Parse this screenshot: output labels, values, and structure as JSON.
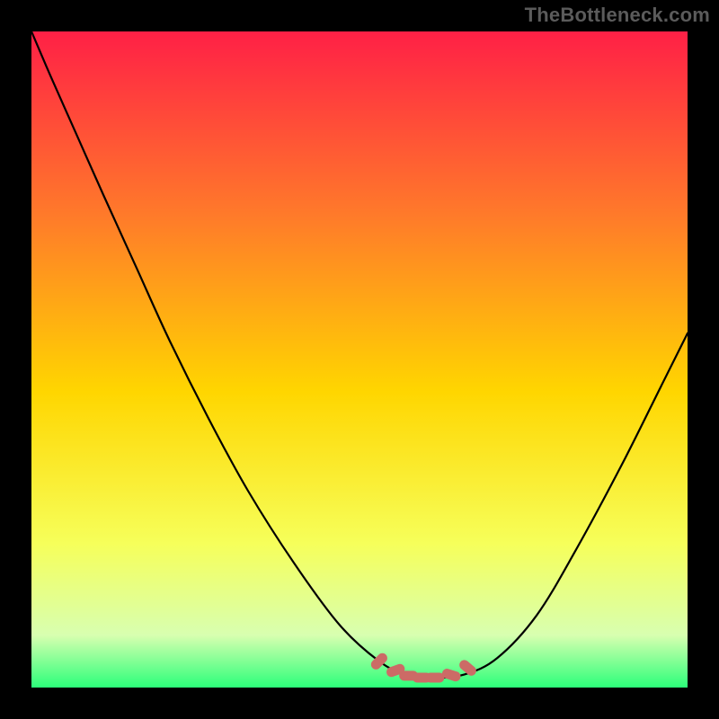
{
  "attribution": "TheBottleneck.com",
  "colors": {
    "background": "#000000",
    "attribution_text": "#5b5b5b",
    "gradient_top": "#ff2046",
    "gradient_upper_mid": "#ff7a2a",
    "gradient_mid": "#ffd600",
    "gradient_lower_mid": "#f6ff5a",
    "gradient_near_bottom": "#d8ffb0",
    "gradient_bottom": "#2cff7a",
    "curve_stroke": "#000000",
    "marker_fill": "#cc6b66"
  },
  "chart_data": {
    "type": "line",
    "title": "",
    "xlabel": "",
    "ylabel": "",
    "xlim": [
      0,
      1
    ],
    "ylim": [
      0,
      1
    ],
    "note": "Axes are unlabeled in the source image; x/y are normalized fractions of the plot area (0 = left/bottom, 1 = right/top). The single series is a V-shaped bottleneck curve with its minimum slightly right of center; markers indicate the flat optimum region.",
    "series": [
      {
        "name": "bottleneck-curve",
        "x": [
          0.0,
          0.03,
          0.07,
          0.11,
          0.16,
          0.21,
          0.27,
          0.33,
          0.4,
          0.47,
          0.53,
          0.57,
          0.61,
          0.66,
          0.71,
          0.77,
          0.83,
          0.9,
          0.96,
          1.0
        ],
        "y": [
          1.0,
          0.93,
          0.84,
          0.75,
          0.64,
          0.53,
          0.41,
          0.3,
          0.19,
          0.095,
          0.04,
          0.02,
          0.015,
          0.02,
          0.045,
          0.11,
          0.21,
          0.34,
          0.46,
          0.54
        ]
      }
    ],
    "markers": {
      "name": "optimum-region",
      "x": [
        0.53,
        0.555,
        0.575,
        0.595,
        0.615,
        0.64,
        0.665
      ],
      "y": [
        0.04,
        0.026,
        0.018,
        0.015,
        0.015,
        0.019,
        0.03
      ]
    }
  }
}
